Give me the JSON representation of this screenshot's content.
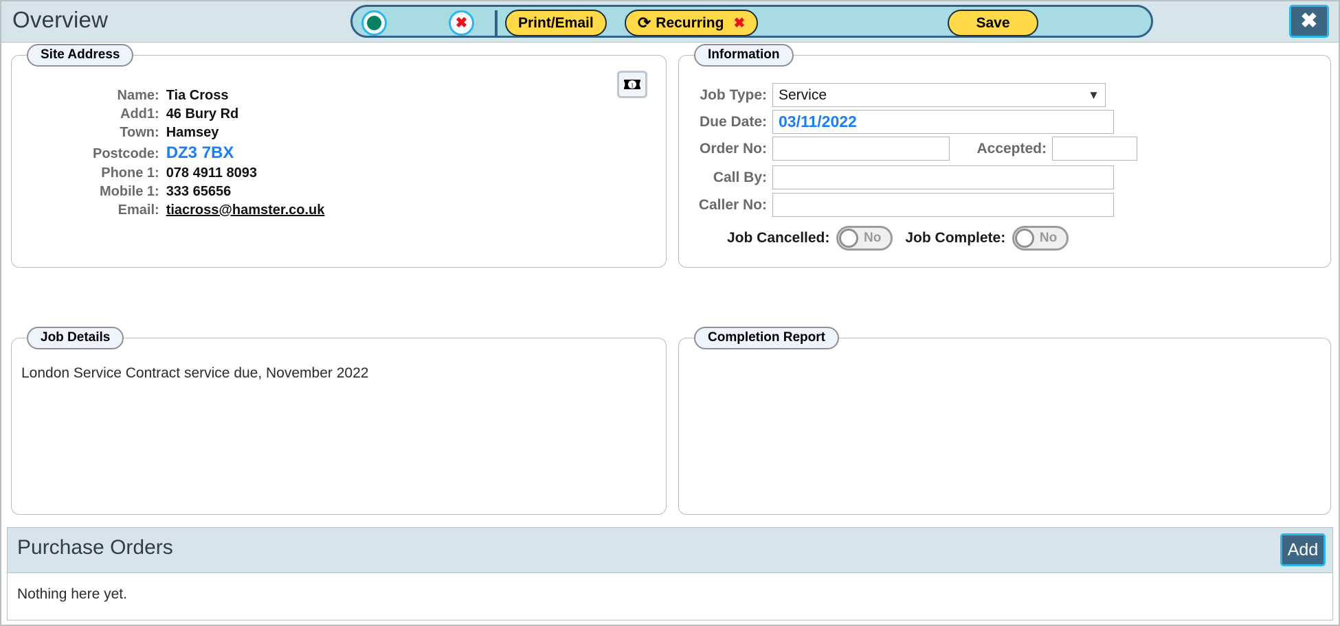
{
  "header": {
    "title": "Overview",
    "toolbar": {
      "status_icon": "green-status-dot",
      "status_color": "#07805f",
      "delete_icon": "red-x-circle",
      "print_email_label": "Print/Email",
      "recurring_label": "Recurring",
      "recurring_icon": "refresh-icon",
      "recurring_remove_icon": "red-x",
      "save_label": "Save",
      "accent_yellow": "#ffd948",
      "accent_border": "#2f6388"
    },
    "close_label": "✖"
  },
  "site_address": {
    "legend": "Site Address",
    "note_icon": "banknote-icon",
    "rows": [
      {
        "label": "Name:",
        "value": "Tia Cross",
        "style": "plain"
      },
      {
        "label": "Add1:",
        "value": "46 Bury Rd",
        "style": "plain"
      },
      {
        "label": "Town:",
        "value": "Hamsey",
        "style": "plain"
      },
      {
        "label": "Postcode:",
        "value": "DZ3 7BX",
        "style": "postcode"
      },
      {
        "label": "Phone 1:",
        "value": "078 4911 8093",
        "style": "plain"
      },
      {
        "label": "Mobile 1:",
        "value": "333 65656",
        "style": "plain"
      },
      {
        "label": "Email:",
        "value": "tiacross@hamster.co.uk",
        "style": "email"
      }
    ]
  },
  "information": {
    "legend": "Information",
    "job_type": {
      "label": "Job Type:",
      "value": "Service",
      "chevron": "∨"
    },
    "due_date": {
      "label": "Due Date:",
      "value": "03/11/2022",
      "color": "#1c7ef7"
    },
    "order_no": {
      "label": "Order No:",
      "value": "",
      "placeholder": ""
    },
    "accepted": {
      "label": "Accepted:",
      "value": "",
      "placeholder": ""
    },
    "call_by": {
      "label": "Call By:",
      "value": "",
      "placeholder": ""
    },
    "caller_no": {
      "label": "Caller No:",
      "value": "",
      "placeholder": ""
    },
    "job_cancelled": {
      "label": "Job Cancelled:",
      "state": "No"
    },
    "job_complete": {
      "label": "Job Complete:",
      "state": "No"
    }
  },
  "job_details": {
    "legend": "Job Details",
    "text": "London Service Contract service due, November 2022"
  },
  "completion_report": {
    "legend": "Completion Report",
    "text": ""
  },
  "purchase_orders": {
    "title": "Purchase Orders",
    "add_label": "Add",
    "empty_text": "Nothing here yet."
  }
}
